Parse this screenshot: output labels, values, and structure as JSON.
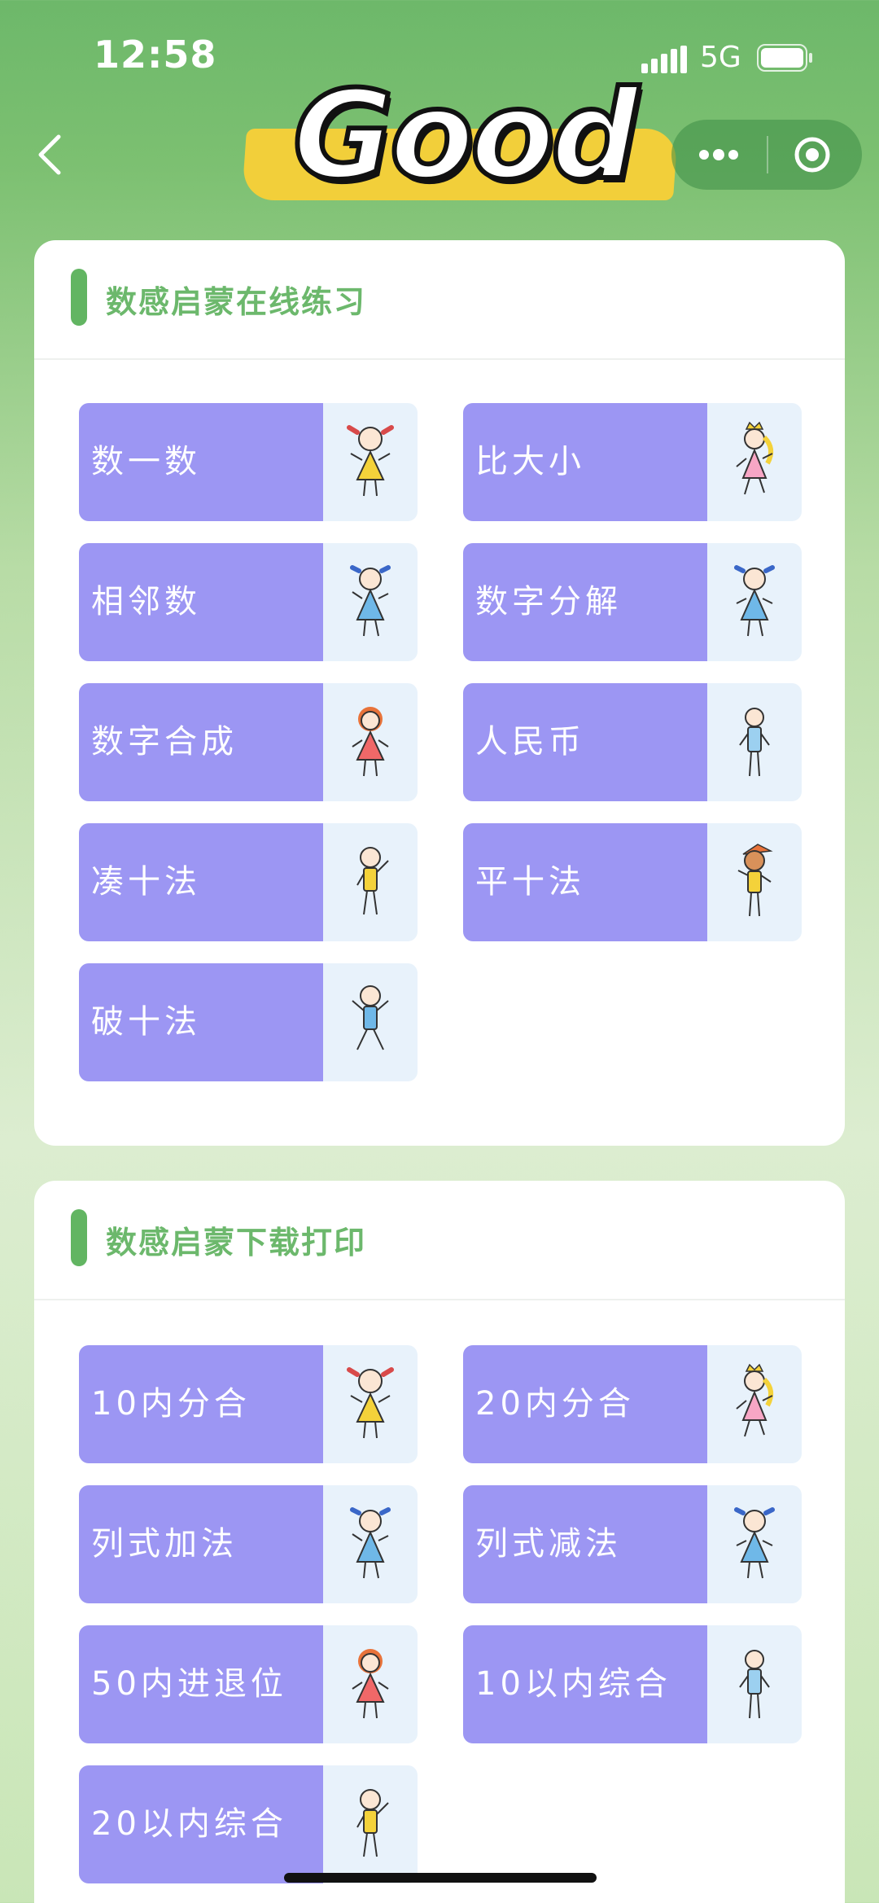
{
  "status_bar": {
    "time": "12:58",
    "network": "5G"
  },
  "banner": {
    "text": "Good"
  },
  "sections": [
    {
      "title": "数感启蒙在线练习",
      "items": [
        {
          "label": "数一数",
          "character": "girl-yellow-dress"
        },
        {
          "label": "比大小",
          "character": "princess-pink-dress"
        },
        {
          "label": "相邻数",
          "character": "girl-blue-dress"
        },
        {
          "label": "数字分解",
          "character": "girl-blue-dress"
        },
        {
          "label": "数字合成",
          "character": "girl-red-dress"
        },
        {
          "label": "人民币",
          "character": "boy-blue-shirt"
        },
        {
          "label": "凑十法",
          "character": "boy-yellow-shirt"
        },
        {
          "label": "平十法",
          "character": "kid-orange-hat"
        },
        {
          "label": "破十法",
          "character": "boy-blue-jumping"
        }
      ]
    },
    {
      "title": "数感启蒙下载打印",
      "items": [
        {
          "label": "10内分合",
          "character": "girl-yellow-dress"
        },
        {
          "label": "20内分合",
          "character": "princess-pink-dress"
        },
        {
          "label": "列式加法",
          "character": "girl-blue-dress"
        },
        {
          "label": "列式减法",
          "character": "girl-blue-dress"
        },
        {
          "label": "50内进退位",
          "character": "girl-red-dress"
        },
        {
          "label": "10以内综合",
          "character": "boy-blue-shirt"
        },
        {
          "label": "20以内综合",
          "character": "boy-yellow-shirt"
        }
      ]
    }
  ],
  "colors": {
    "accent_green": "#62b562",
    "item_purple": "#9c96f3",
    "item_pic_bg": "#e8f2fb",
    "banner_yellow": "#f2cf3a"
  }
}
